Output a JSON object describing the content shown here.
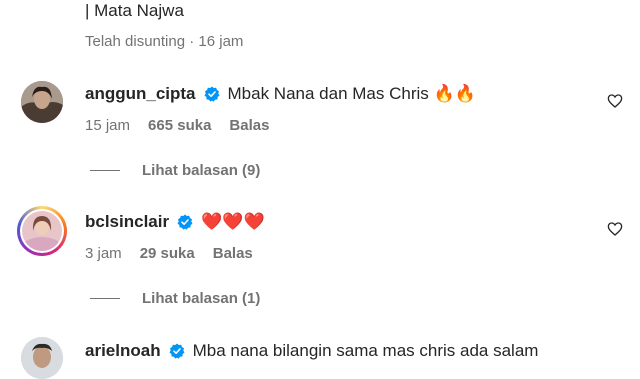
{
  "caption": {
    "tail_text": "| Mata Najwa",
    "meta_text": "Telah disunting · 16 jam"
  },
  "comments": [
    {
      "username": "anggun_cipta",
      "text": "Mbak Nana dan Mas Chris 🔥🔥",
      "time": "15 jam",
      "likes": "665 suka",
      "reply_label": "Balas",
      "view_replies": "Lihat balasan (9)"
    },
    {
      "username": "bclsinclair",
      "text": "❤️❤️❤️",
      "time": "3 jam",
      "likes": "29 suka",
      "reply_label": "Balas",
      "view_replies": "Lihat balasan (1)"
    },
    {
      "username": "arielnoah",
      "text": "Mba nana bilangin sama mas chris ada salam"
    }
  ],
  "colors": {
    "verified_blue": "#0095f6",
    "secondary_text": "#737373",
    "primary_text": "#262626"
  }
}
